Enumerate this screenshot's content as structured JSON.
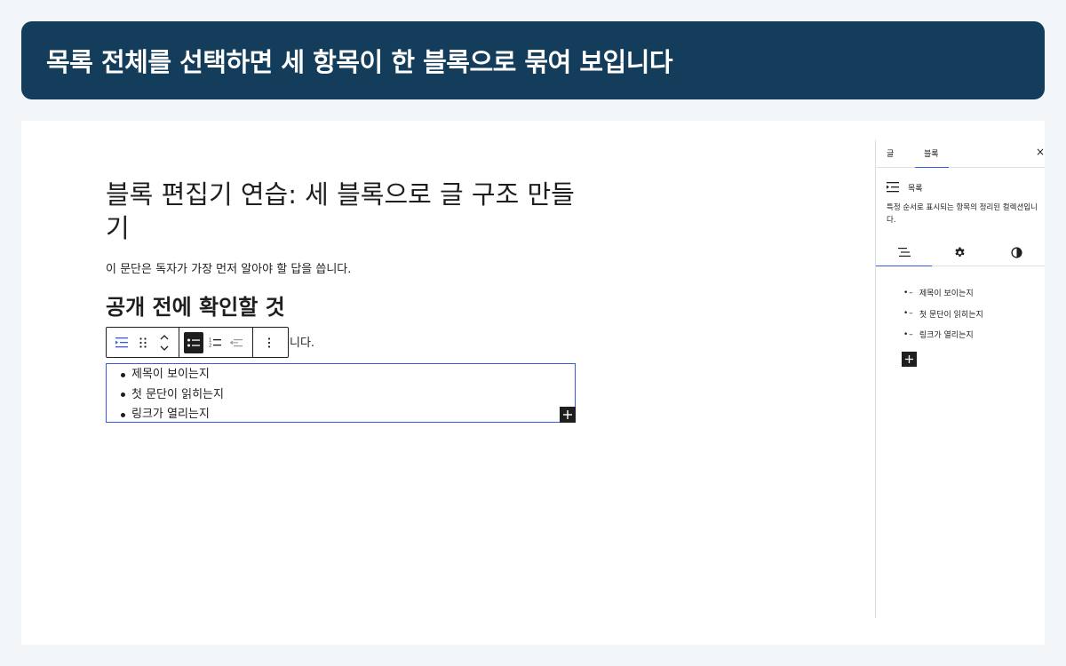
{
  "banner": {
    "title": "목록 전체를 선택하면 세 항목이 한 블록으로 묶여 보입니다"
  },
  "editor": {
    "post_title": "블록 편집기 연습: 세 블록으로 글 구조 만들기",
    "paragraph1": "이 문단은 독자가 가장 먼저 알아야 할 답을 씁니다.",
    "heading": "공개 전에 확인할 것",
    "paragraph2_visible_tail": "니다.",
    "list_items": [
      "제목이 보이는지",
      "첫 문단이 읽히는지",
      "링크가 열리는지"
    ]
  },
  "toolbar": {
    "icons": [
      "list-block-type-icon",
      "drag-handle-icon",
      "move-up-down-icon",
      "unordered-list-icon",
      "ordered-list-icon",
      "outdent-icon",
      "options-icon"
    ]
  },
  "sidebar": {
    "tabs": [
      "글",
      "블록"
    ],
    "active_tab": "블록",
    "close_label": "×",
    "block_name": "목록",
    "block_description": "특정 순서로 표시되는 항목의 정리된 컬렉션입니다.",
    "icon_tabs": [
      "list-view-icon",
      "settings-gear-icon",
      "styles-contrast-icon"
    ],
    "items": [
      "제목이 보이는지",
      "첫 문단이 읽히는지",
      "링크가 열리는지"
    ],
    "item_marker": "•–"
  },
  "colors": {
    "banner_bg": "#143d5c",
    "accent": "#3858e9",
    "text": "#1e1e1e"
  }
}
